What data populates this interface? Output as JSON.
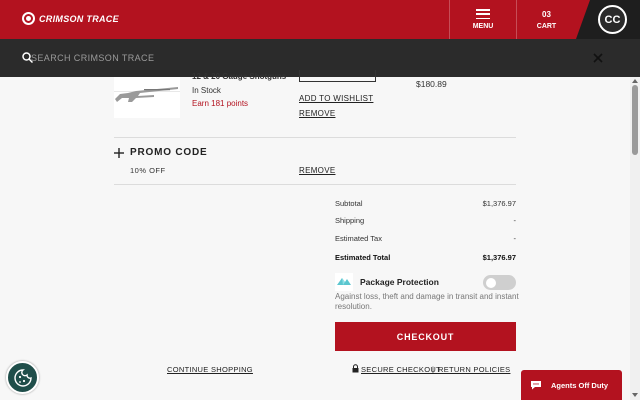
{
  "header": {
    "logo_text": "CRIMSON TRACE",
    "menu_label": "MENU",
    "cart_count": "03",
    "cart_label": "CART",
    "badge_text": "CC",
    "brand_color": "#b3121f"
  },
  "search": {
    "placeholder": "SEARCH CRIMSON TRACE",
    "icon": "search-icon",
    "close_icon": "close-icon"
  },
  "cart_item": {
    "title": "12 & 20 Gauge Shotguns",
    "stock": "In Stock",
    "points": "Earn 181 points",
    "wishlist_label": "ADD TO WISHLIST",
    "remove_label": "REMOVE",
    "price": "$180.89"
  },
  "promo": {
    "label": "PROMO CODE",
    "applied_code": "10% OFF",
    "remove_label": "REMOVE"
  },
  "summary": {
    "rows": [
      {
        "label": "Subtotal",
        "value": "$1,376.97"
      },
      {
        "label": "Shipping",
        "value": "-"
      },
      {
        "label": "Estimated Tax",
        "value": "-"
      }
    ],
    "total_label": "Estimated Total",
    "total_value": "$1,376.97"
  },
  "package_protection": {
    "label": "Package Protection",
    "description": "Against loss, theft and damage in transit and instant resolution.",
    "enabled": false
  },
  "checkout": {
    "button_label": "CHECKOUT",
    "continue_label": "CONTINUE SHOPPING",
    "secure_label": "SECURE CHECKOUT",
    "separator": "|",
    "returns_label": "RETURN POLICIES"
  },
  "chat": {
    "label": "Agents Off Duty"
  }
}
